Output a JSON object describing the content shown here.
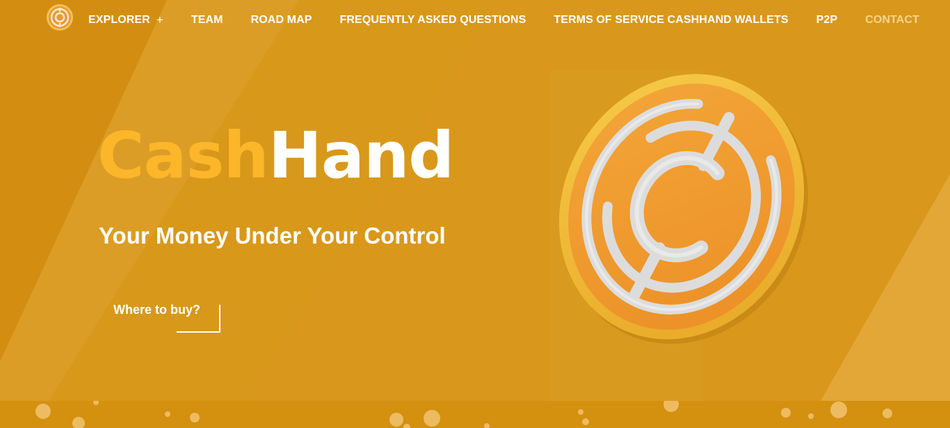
{
  "nav": {
    "items": [
      {
        "label": "EXPLORER",
        "plus": "+",
        "active": false
      },
      {
        "label": "TEAM",
        "active": false
      },
      {
        "label": "ROAD MAP",
        "active": false
      },
      {
        "label": "FREQUENTLY ASKED QUESTIONS",
        "active": false
      },
      {
        "label": "TERMS OF SERVICE CASHHAND WALLETS",
        "active": false
      },
      {
        "label": "P2P",
        "active": false
      },
      {
        "label": "CONTACT",
        "active": true
      }
    ]
  },
  "hero": {
    "brand_part1": "Cash",
    "brand_part2": "Hand",
    "tagline": "Your Money Under Your Control",
    "cta_label": "Where to buy?"
  },
  "colors": {
    "background": "#d9981c",
    "brand_yellow": "#fbb62a",
    "nav_active": "#f6d48c",
    "text": "#ffffff",
    "coin_orange": "#f0a030",
    "coin_silver": "#e6e6e6"
  },
  "icons": {
    "logo": "cashhand-coin-logo-icon",
    "coin_graphic": "cashhand-coin-icon"
  }
}
